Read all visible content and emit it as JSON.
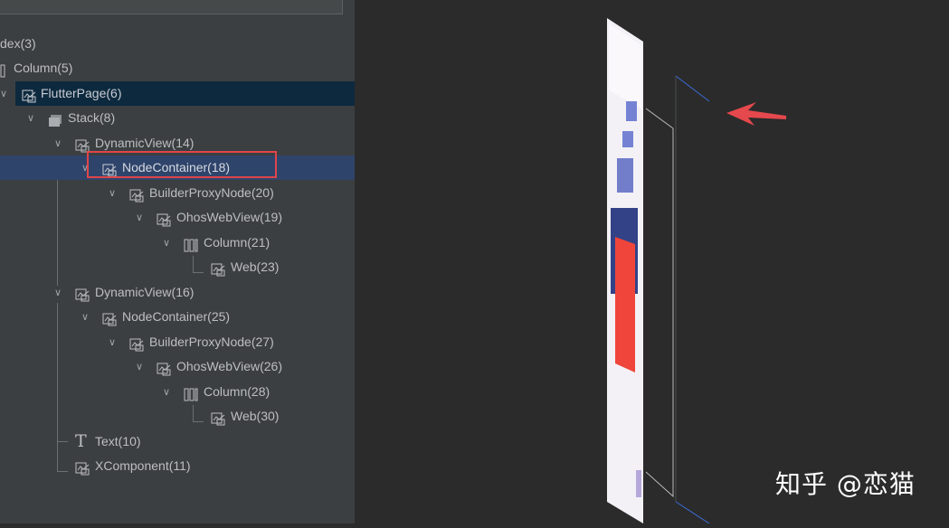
{
  "tree": {
    "nodes": [
      {
        "label": "dex(3)",
        "icon": "none"
      },
      {
        "label": "Column(5)",
        "icon": "column-icon"
      },
      {
        "label": "FlutterPage(6)",
        "icon": "component-icon"
      },
      {
        "label": "Stack(8)",
        "icon": "stack-icon"
      },
      {
        "label": "DynamicView(14)",
        "icon": "component-icon"
      },
      {
        "label": "NodeContainer(18)",
        "icon": "component-icon"
      },
      {
        "label": "BuilderProxyNode(20)",
        "icon": "component-icon"
      },
      {
        "label": "OhosWebView(19)",
        "icon": "component-icon"
      },
      {
        "label": "Column(21)",
        "icon": "column-icon"
      },
      {
        "label": "Web(23)",
        "icon": "component-icon"
      },
      {
        "label": "DynamicView(16)",
        "icon": "component-icon"
      },
      {
        "label": "NodeContainer(25)",
        "icon": "component-icon"
      },
      {
        "label": "BuilderProxyNode(27)",
        "icon": "component-icon"
      },
      {
        "label": "OhosWebView(26)",
        "icon": "component-icon"
      },
      {
        "label": "Column(28)",
        "icon": "column-icon"
      },
      {
        "label": "Web(30)",
        "icon": "component-icon"
      },
      {
        "label": "Text(10)",
        "icon": "text-icon"
      },
      {
        "label": "XComponent(11)",
        "icon": "component-icon"
      }
    ],
    "selected": "FlutterPage(6)",
    "highlighted": "NodeContainer(18)"
  },
  "watermark": "知乎 @恋猫",
  "colors": {
    "panel_bg": "#3c3f41",
    "view_bg": "#2b2b2b",
    "selected_row": "#0d293e",
    "current_row": "#2f446b",
    "highlight_border": "#e0454a",
    "arrow": "#e5484d",
    "device_red": "#f0453a"
  }
}
